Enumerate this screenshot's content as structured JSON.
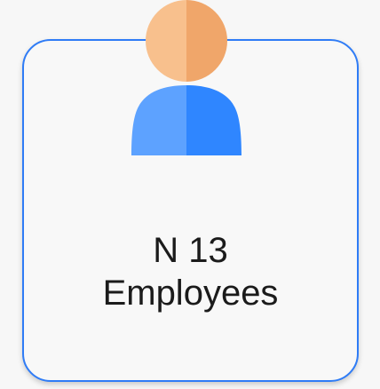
{
  "card": {
    "line1": "N 13",
    "line2": "Employees"
  },
  "icon": {
    "name": "employee-avatar-icon",
    "head_color_light": "#f8c08d",
    "head_color_dark": "#f0a66a",
    "body_color_light": "#5da2ff",
    "body_color_dark": "#2f86ff",
    "border_color": "#2f7cf6"
  }
}
